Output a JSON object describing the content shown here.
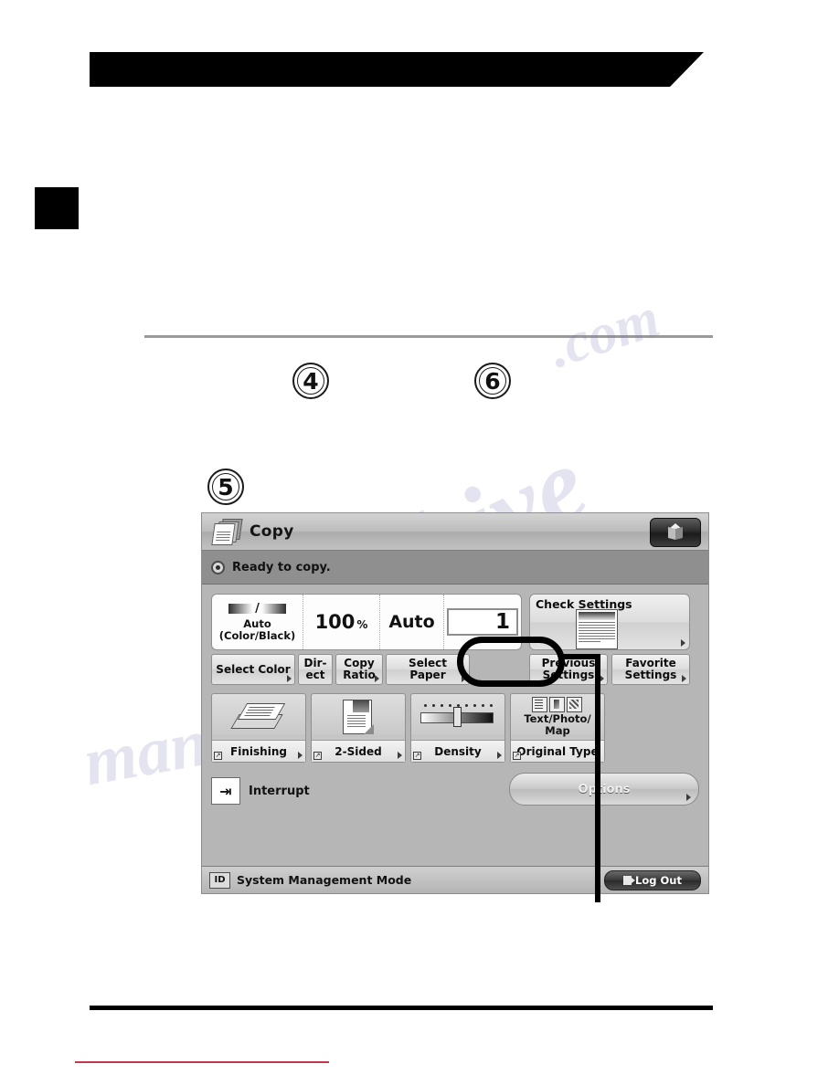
{
  "page": {
    "step_numbers": [
      "4",
      "6",
      "5"
    ],
    "watermark": [
      "alshive",
      "manualshive",
      ".com"
    ]
  },
  "panel": {
    "titlebar": {
      "icon": "documents-stack-icon",
      "title": "Copy",
      "cube_button_icon": "cube-icon"
    },
    "statusbar": {
      "icon": "status-indicator-icon",
      "message": "Ready to copy."
    },
    "basic_settings": {
      "color": {
        "value_line1": "Auto",
        "value_line2": "(Color/Black)",
        "slash": "/",
        "button_label": "Select Color"
      },
      "copy_ratio": {
        "value": "100",
        "unit": "%",
        "button_direct": "Dir-\nect",
        "button_ratio": "Copy\nRatio"
      },
      "paper": {
        "value": "Auto",
        "button_label": "Select Paper"
      },
      "quantity": {
        "value": "1"
      }
    },
    "right_column": {
      "check_settings_label": "Check Settings",
      "previous_settings_label": "Previous\nSettings",
      "favorite_settings_label": "Favorite\nSettings"
    },
    "features": [
      {
        "label": "Finishing",
        "icon": "finishing-icon"
      },
      {
        "label": "2-Sided",
        "icon": "two-sided-icon"
      },
      {
        "label": "Density",
        "icon": "density-slider-icon"
      },
      {
        "label": "Original Type",
        "icon": "original-type-icon",
        "value": "Text/Photo/\nMap"
      }
    ],
    "interrupt": {
      "icon": "interrupt-icon",
      "label": "Interrupt"
    },
    "options_button_label": "Options",
    "footer": {
      "id_badge": "ID",
      "mode_label": "System Management Mode",
      "logout_label": "Log Out",
      "logout_icon": "logout-door-icon"
    }
  },
  "colors": {
    "panel_bg": "#b6b6b6",
    "titlebar": "#c2c2c2",
    "statusbar": "#8f8f8f",
    "accent_black": "#000000",
    "red_rule": "#c0394b"
  }
}
